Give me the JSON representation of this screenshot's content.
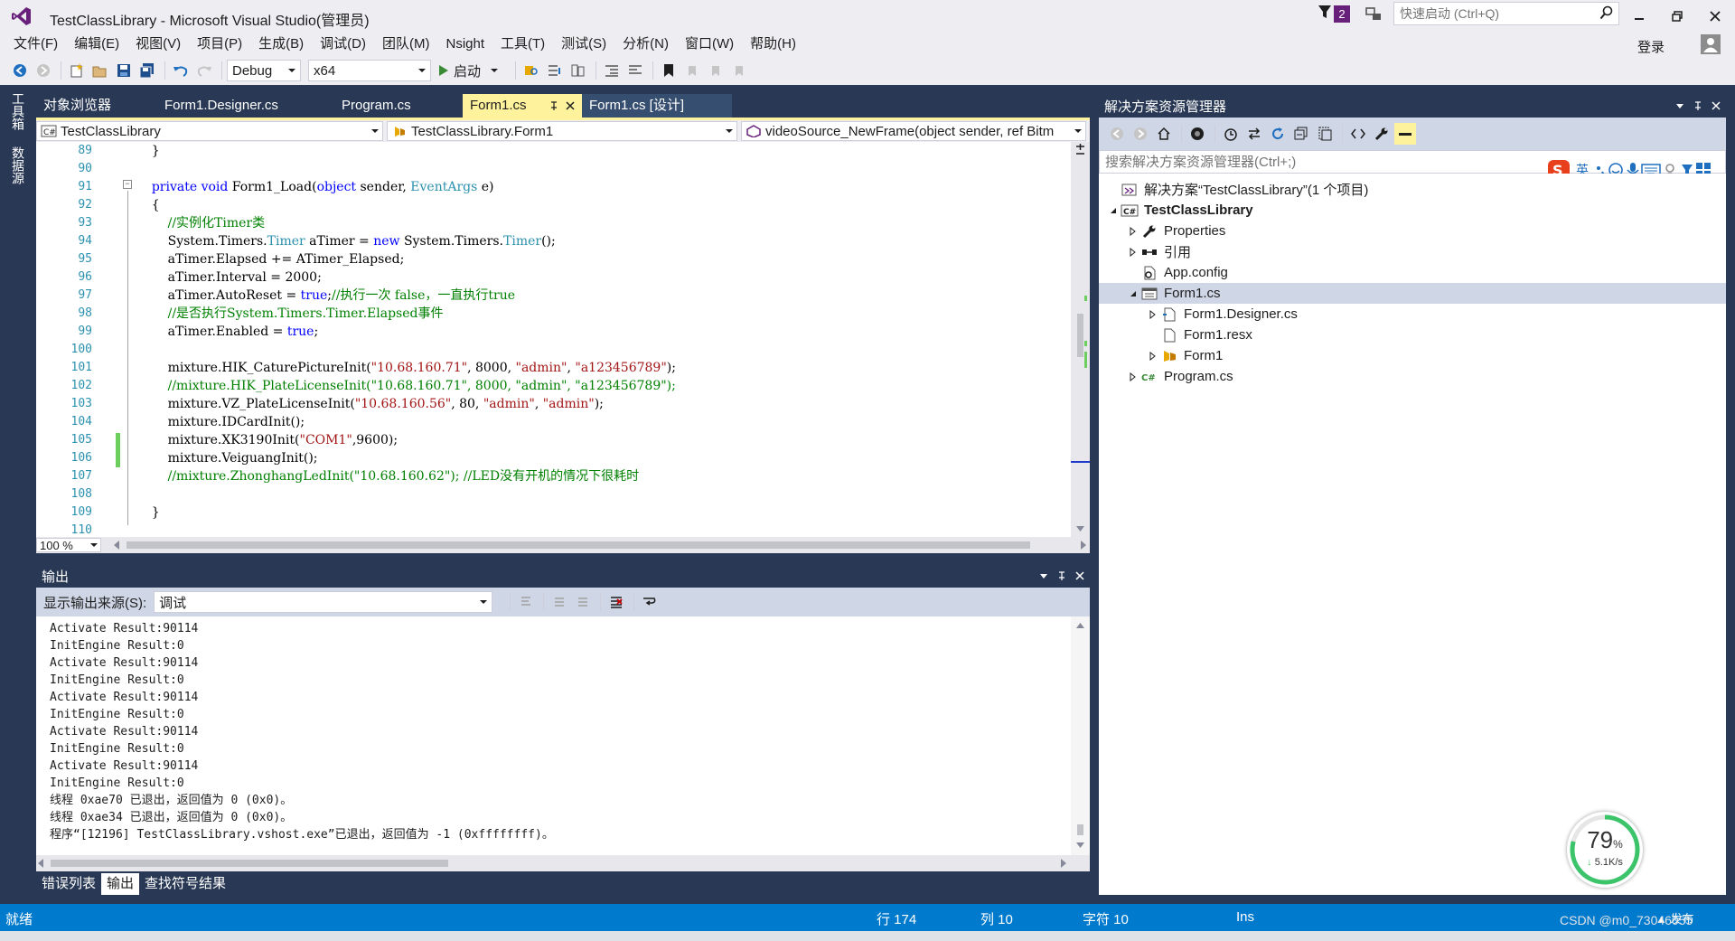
{
  "title_bar": {
    "title": "TestClassLibrary - Microsoft Visual Studio(管理员)",
    "notification_count": "2",
    "quick_launch_placeholder": "快速启动 (Ctrl+Q)"
  },
  "menu": [
    "文件(F)",
    "编辑(E)",
    "视图(V)",
    "项目(P)",
    "生成(B)",
    "调试(D)",
    "团队(M)",
    "Nsight",
    "工具(T)",
    "测试(S)",
    "分析(N)",
    "窗口(W)",
    "帮助(H)"
  ],
  "account": {
    "login": "登录"
  },
  "toolbar": {
    "configuration": "Debug",
    "platform": "x64",
    "start_label": "启动"
  },
  "left_rail": {
    "toolbox": "工具箱",
    "datasource": "数据源"
  },
  "doc_tabs": [
    {
      "label": "对象浏览器"
    },
    {
      "label": "Form1.Designer.cs"
    },
    {
      "label": "Program.cs"
    },
    {
      "label": "Form1.cs"
    },
    {
      "label": "Form1.cs [设计]"
    }
  ],
  "nav_bar": {
    "project": "TestClassLibrary",
    "class": "TestClassLibrary.Form1",
    "member": "videoSource_NewFrame(object sender, ref Bitm"
  },
  "editor": {
    "zoom": "100 %",
    "line_numbers": [
      "89",
      "90",
      "91",
      "92",
      "93",
      "94",
      "95",
      "96",
      "97",
      "98",
      "99",
      "100",
      "101",
      "102",
      "103",
      "104",
      "105",
      "106",
      "107",
      "108",
      "109",
      "110"
    ]
  },
  "output": {
    "title": "输出",
    "source_label": "显示输出来源(S):",
    "source_value": "调试",
    "lines": [
      "Activate Result:90114",
      "InitEngine Result:0",
      "Activate Result:90114",
      "InitEngine Result:0",
      "Activate Result:90114",
      "InitEngine Result:0",
      "Activate Result:90114",
      "InitEngine Result:0",
      "Activate Result:90114",
      "InitEngine Result:0",
      "线程 0xae70 已退出，返回值为 0 (0x0)。",
      "线程 0xae34 已退出，返回值为 0 (0x0)。",
      "程序“[12196] TestClassLibrary.vshost.exe”已退出，返回值为 -1 (0xffffffff)。"
    ]
  },
  "bottom_tabs": [
    "错误列表",
    "输出",
    "查找符号结果"
  ],
  "solution_explorer": {
    "title": "解决方案资源管理器",
    "search_placeholder": "搜索解决方案资源管理器(Ctrl+;)",
    "ime_label": "英",
    "tree": [
      {
        "label": "解决方案“TestClassLibrary”(1 个项目)",
        "icon": "solution-icon"
      },
      {
        "label": "TestClassLibrary",
        "icon": "csharp-project-icon"
      },
      {
        "label": "Properties",
        "icon": "wrench-icon"
      },
      {
        "label": "引用",
        "icon": "references-icon"
      },
      {
        "label": "App.config",
        "icon": "config-file-icon"
      },
      {
        "label": "Form1.cs",
        "icon": "form-icon"
      },
      {
        "label": "Form1.Designer.cs",
        "icon": "cs-file-icon"
      },
      {
        "label": "Form1.resx",
        "icon": "resx-file-icon"
      },
      {
        "label": "Form1",
        "icon": "class-icon"
      },
      {
        "label": "Program.cs",
        "icon": "csharp-file-icon"
      }
    ]
  },
  "net_widget": {
    "percent": "79",
    "percent_unit": "%",
    "speed": "5.1K/s"
  },
  "status_bar": {
    "state": "就绪",
    "line": "行 174",
    "column": "列 10",
    "char": "字符 10",
    "mode": "Ins",
    "publish": "发布",
    "watermark": "CSDN @m0_73046055"
  },
  "colors": {
    "accent": "#007acc",
    "chrome": "#293955",
    "active_tab": "#fff29d",
    "keyword": "#0000ff",
    "type": "#2b91af",
    "comment": "#008000",
    "string": "#a31515"
  }
}
